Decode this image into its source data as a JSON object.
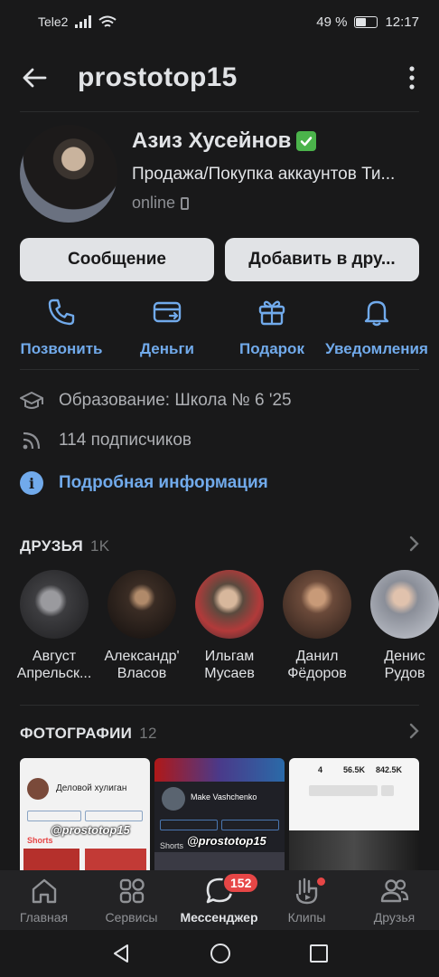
{
  "status_bar": {
    "carrier": "Tele2",
    "battery": "49 %",
    "time": "12:17"
  },
  "header": {
    "title": "prostotop15"
  },
  "profile": {
    "name": "Азиз Хусейнов",
    "status": "Продажа/Покупка аккаунтов Ти...",
    "online": "online"
  },
  "buttons": {
    "message": "Сообщение",
    "add_friend": "Добавить в дру..."
  },
  "actions": [
    {
      "label": "Позвонить",
      "icon": "phone-icon"
    },
    {
      "label": "Деньги",
      "icon": "money-icon"
    },
    {
      "label": "Подарок",
      "icon": "gift-icon"
    },
    {
      "label": "Уведомления",
      "icon": "bell-icon"
    }
  ],
  "info": {
    "education": "Образование: Школа № 6 '25",
    "subscribers": "114 подписчиков",
    "details": "Подробная информация"
  },
  "friends": {
    "title": "ДРУЗЬЯ",
    "count": "1K",
    "items": [
      {
        "first": "Август",
        "last": "Апрельск...",
        "color": "#3d3d40"
      },
      {
        "first": "Александр'",
        "last": "Власов",
        "color": "#2a2320"
      },
      {
        "first": "Ильгам",
        "last": "Мусаев",
        "color": "#5a4a3e"
      },
      {
        "first": "Данил",
        "last": "Фёдоров",
        "color": "#6b4a3a"
      },
      {
        "first": "Денис",
        "last": "Рудов",
        "color": "#8a8e98"
      }
    ]
  },
  "photos": {
    "title": "ФОТОГРАФИИ",
    "count": "12",
    "watermark": "@prostotop15",
    "photo1_name": "Деловой хулиган",
    "photo2_name": "Make Vashchenko",
    "photo1_shorts": "Shorts",
    "photo2_shorts": "Shorts",
    "photo3_stats": [
      "4",
      "56.5K",
      "842.5K"
    ]
  },
  "tabbar": {
    "items": [
      {
        "label": "Главная",
        "icon": "home-icon"
      },
      {
        "label": "Сервисы",
        "icon": "services-icon"
      },
      {
        "label": "Мессенджер",
        "icon": "messenger-icon",
        "badge": "152"
      },
      {
        "label": "Клипы",
        "icon": "clips-icon"
      },
      {
        "label": "Друзья",
        "icon": "friends-icon"
      }
    ]
  },
  "colors": {
    "accent": "#71aaeb",
    "background": "#19191a",
    "badge": "#e64646",
    "verified": "#4bb34b"
  }
}
